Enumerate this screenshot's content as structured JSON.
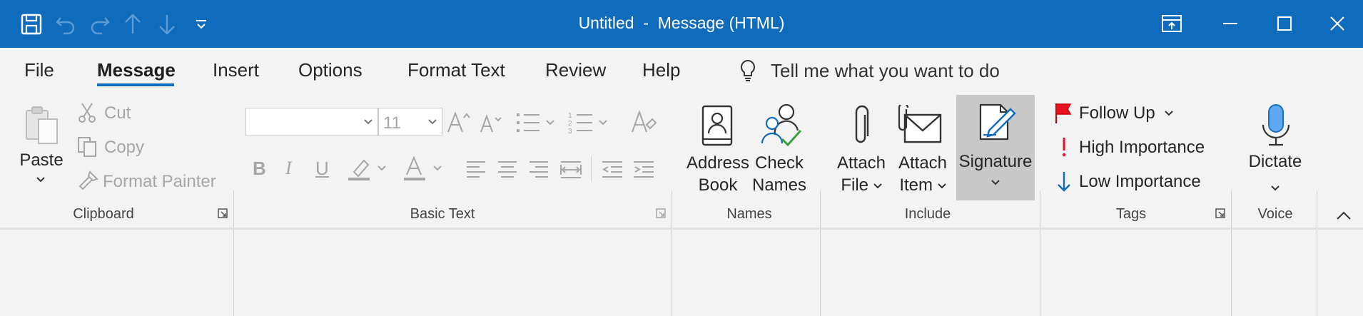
{
  "window": {
    "title": "Untitled  -  Message (HTML)"
  },
  "quick_access": [
    "save-icon",
    "undo-icon",
    "redo-icon",
    "up-arrow-icon",
    "down-arrow-icon",
    "customize-qat-icon"
  ],
  "tabs": [
    {
      "label": "File"
    },
    {
      "label": "Message",
      "active": true
    },
    {
      "label": "Insert"
    },
    {
      "label": "Options"
    },
    {
      "label": "Format Text"
    },
    {
      "label": "Review"
    },
    {
      "label": "Help"
    }
  ],
  "tell_me": {
    "label": "Tell me what you want to do"
  },
  "ribbon": {
    "clipboard": {
      "group_label": "Clipboard",
      "paste": "Paste",
      "cut": "Cut",
      "copy": "Copy",
      "format_painter": "Format Painter"
    },
    "basic_text": {
      "group_label": "Basic Text",
      "font_name": "",
      "font_size": "11",
      "bold": "B",
      "italic": "I",
      "underline": "U"
    },
    "names": {
      "group_label": "Names",
      "address_book": [
        "Address",
        "Book"
      ],
      "check_names": [
        "Check",
        "Names"
      ]
    },
    "include": {
      "group_label": "Include",
      "attach_file": [
        "Attach",
        "File"
      ],
      "attach_item": [
        "Attach",
        "Item"
      ],
      "signature": "Signature"
    },
    "tags": {
      "group_label": "Tags",
      "follow_up": "Follow Up",
      "high_importance": "High Importance",
      "low_importance": "Low Importance"
    },
    "voice": {
      "group_label": "Voice",
      "dictate": "Dictate"
    }
  },
  "colors": {
    "title_bar": "#0f6cbd",
    "accent": "#0f6cbd",
    "ribbon_bg": "#f3f3f3",
    "selected_button": "#c8c8c8",
    "flag_red": "#e81123"
  }
}
